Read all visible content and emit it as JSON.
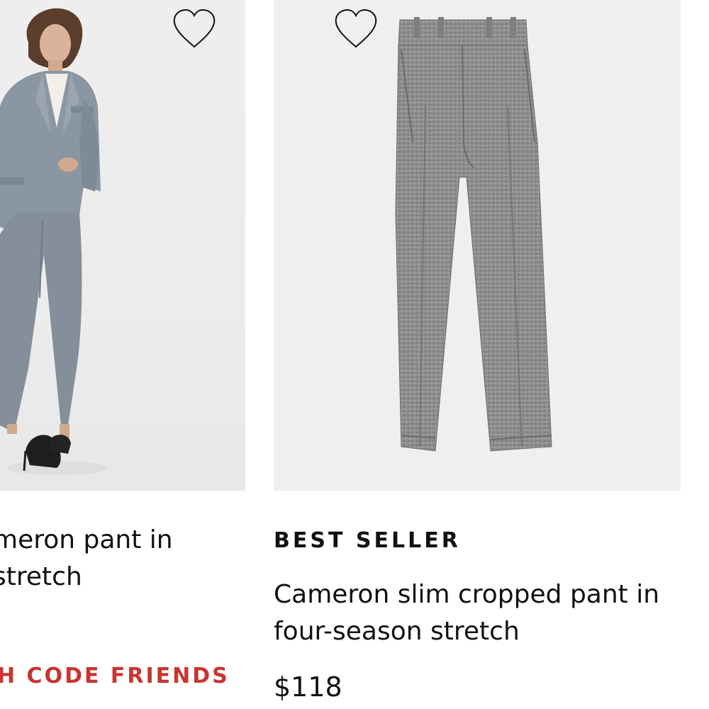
{
  "products": [
    {
      "title_lines": [
        "Cameron pant in",
        "four-season stretch"
      ],
      "visible_title_lines": [
        "meron pant in",
        " stretch"
      ],
      "promo": "H CODE FRIENDS",
      "image_icon": "woman-in-gray-suit-photo",
      "wishlist_icon": "heart-outline-icon"
    },
    {
      "badge": "BEST SELLER",
      "title_lines": [
        "Cameron slim cropped pant in",
        "four-season stretch"
      ],
      "price": "$118",
      "image_icon": "gray-trousers-photo",
      "wishlist_icon": "heart-outline-icon"
    }
  ],
  "colors": {
    "promo": "#c8352e",
    "text": "#111111",
    "image_bg": "#efefef",
    "fabric": "#8a8a8a"
  }
}
